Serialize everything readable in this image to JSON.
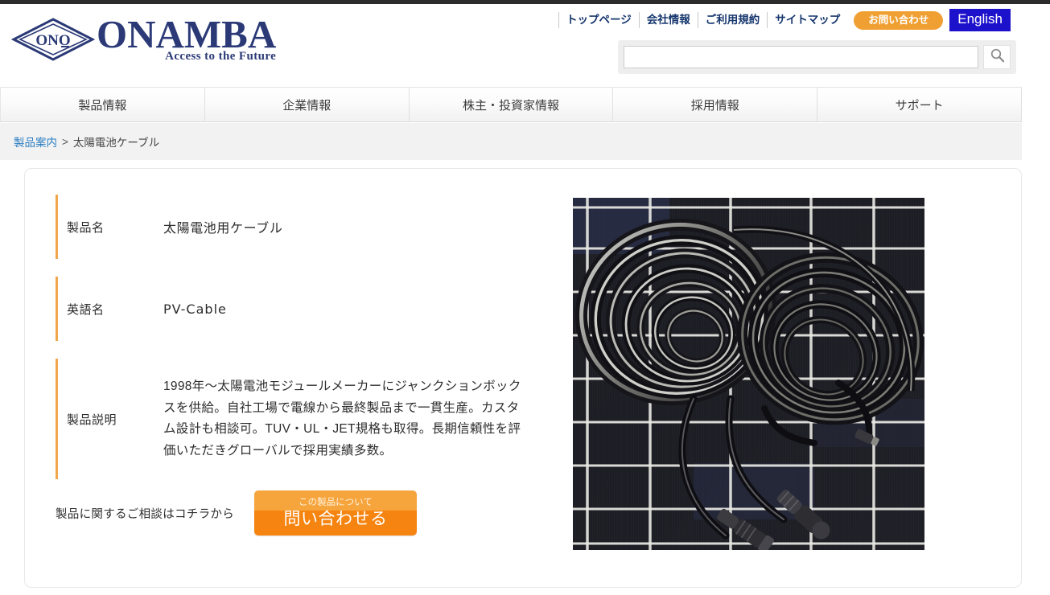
{
  "header": {
    "logo": {
      "wordmark": "ONAMBA",
      "tagline": "Access to the Future",
      "mark_text": "ONO",
      "icon": "diamond-logo-icon"
    },
    "utility_nav": [
      {
        "label": "トップページ",
        "name": "top-page"
      },
      {
        "label": "会社情報",
        "name": "company-info"
      },
      {
        "label": "ご利用規約",
        "name": "terms-of-use"
      },
      {
        "label": "サイトマップ",
        "name": "sitemap"
      }
    ],
    "contact_pill": {
      "label": "お問い合わせ",
      "color": "#f0a033"
    },
    "language_button": {
      "label": "English",
      "color": "#1d12cb"
    },
    "search": {
      "value": "",
      "placeholder": "",
      "icon": "search-icon"
    }
  },
  "main_nav": [
    {
      "label": "製品情報"
    },
    {
      "label": "企業情報"
    },
    {
      "label": "株主・投資家情報"
    },
    {
      "label": "採用情報"
    },
    {
      "label": "サポート"
    }
  ],
  "breadcrumb": {
    "link": "製品案内",
    "separator": ">",
    "current": "太陽電池ケーブル",
    "link_color": "#2b7ec1"
  },
  "product": {
    "rows": [
      {
        "label": "製品名",
        "value": "太陽電池用ケーブル"
      },
      {
        "label": "英語名",
        "value": "PV-Cable"
      },
      {
        "label": "製品説明",
        "value": "1998年〜太陽電池モジュールメーカーにジャンクションボックスを供給。自社工場で電線から最終製品まで一貫生産。カスタム設計も相談可。TUV・UL・JET規格も取得。長期信頼性を評価いただきグローバルで採用実績多数。"
      }
    ],
    "accent_color": "#f0a64a",
    "image_alt": "太陽電池パネル上に巻かれたPVケーブルとMC4コネクタ"
  },
  "cta": {
    "text": "製品に関するご相談はコチラから",
    "button_small": "この製品について",
    "button_large": "問い合わせる",
    "button_color": "#f58410"
  }
}
